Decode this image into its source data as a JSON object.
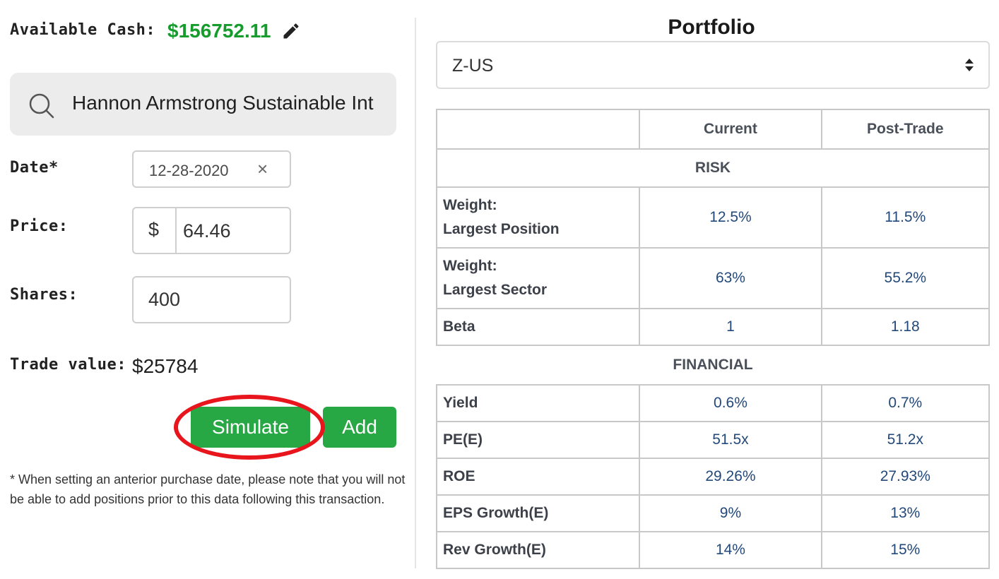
{
  "left_panel": {
    "cash_label": "Available Cash:",
    "cash_value": "$156752.11",
    "search_value": "Hannon Armstrong Sustainable Int",
    "date_label": "Date*",
    "date_value": "12-28-2020",
    "date_clear": "×",
    "price_label": "Price:",
    "price_prefix": "$",
    "price_value": "64.46",
    "shares_label": "Shares:",
    "shares_value": "400",
    "trade_label": "Trade value:",
    "trade_value": "$25784",
    "simulate_label": "Simulate",
    "add_label": "Add",
    "note": "* When setting an anterior purchase date, please note that you will not be able to add positions prior to this data following this transaction.",
    "icons": [
      "pencil-icon",
      "search-icon",
      "close-icon"
    ]
  },
  "portfolio": {
    "title": "Portfolio",
    "selected": "Z-US",
    "columns": [
      "",
      "Current",
      "Post-Trade"
    ],
    "risk_header": "RISK",
    "risk_rows": [
      {
        "line1": "Weight:",
        "line2": "Largest Position",
        "current": "12.5%",
        "post": "11.5%"
      },
      {
        "line1": "Weight:",
        "line2": "Largest Sector",
        "current": "63%",
        "post": "55.2%"
      },
      {
        "line1": "Beta",
        "line2": "",
        "current": "1",
        "post": "1.18"
      }
    ],
    "financial_header": "FINANCIAL",
    "financial_rows": [
      {
        "label": "Yield",
        "current": "0.6%",
        "post": "0.7%"
      },
      {
        "label": "PE(E)",
        "current": "51.5x",
        "post": "51.2x"
      },
      {
        "label": "ROE",
        "current": "29.26%",
        "post": "27.93%"
      },
      {
        "label": "EPS Growth(E)",
        "current": "9%",
        "post": "13%"
      },
      {
        "label": "Rev Growth(E)",
        "current": "14%",
        "post": "15%"
      }
    ]
  },
  "colors": {
    "cash_green": "#159c2c",
    "button_green": "#28a745",
    "highlight_red": "#e8151d",
    "value_blue": "#23497a"
  }
}
